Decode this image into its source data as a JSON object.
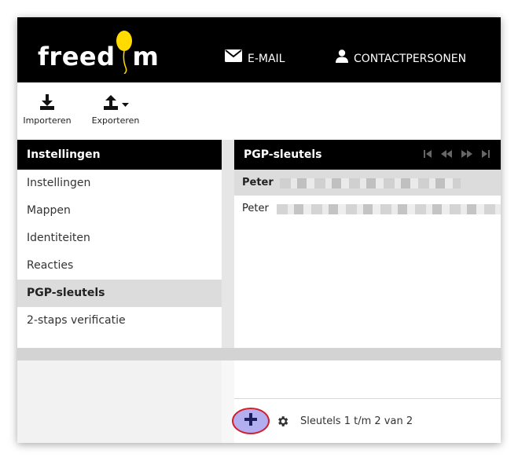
{
  "header": {
    "logo_left": "freed",
    "logo_right": "m",
    "nav": [
      {
        "label": "E-MAIL",
        "icon": "envelope-icon"
      },
      {
        "label": "CONTACTPERSONEN",
        "icon": "user-icon"
      }
    ]
  },
  "toolbar": {
    "import_label": "Importeren",
    "export_label": "Exporteren"
  },
  "settings": {
    "title": "Instellingen",
    "items": [
      {
        "label": "Instellingen"
      },
      {
        "label": "Mappen"
      },
      {
        "label": "Identiteiten"
      },
      {
        "label": "Reacties"
      },
      {
        "label": "PGP-sleutels",
        "active": true
      },
      {
        "label": "2-staps verificatie"
      }
    ]
  },
  "keys": {
    "title": "PGP-sleutels",
    "rows": [
      {
        "name": "Peter",
        "selected": true
      },
      {
        "name": "Peter",
        "selected": false
      }
    ],
    "footer_text": "Sleutels 1 t/m 2 van 2"
  },
  "colors": {
    "header_bg": "#000000",
    "selected_row": "#dcdcdc",
    "add_button_fill": "#b3aef0",
    "add_button_ring": "#d41e2b",
    "logo_balloon": "#ffdb00"
  }
}
